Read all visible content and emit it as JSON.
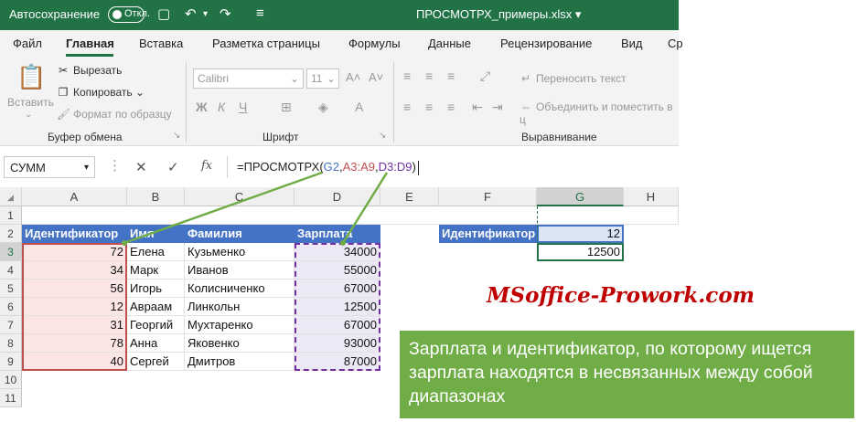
{
  "titlebar": {
    "autosave_label": "Автосохранение",
    "autosave_state": "Откл.",
    "document_title": "ПРОСМОТРХ_примеры.xlsx ▾"
  },
  "menu": {
    "tabs": [
      "Файл",
      "Главная",
      "Вставка",
      "Разметка страницы",
      "Формулы",
      "Данные",
      "Рецензирование",
      "Вид",
      "Ср"
    ],
    "active_tab": "Главная"
  },
  "ribbon": {
    "clipboard": {
      "paste": "Вставить",
      "cut": "Вырезать",
      "copy": "Копировать",
      "format_painter": "Формат по образцу",
      "group": "Буфер обмена"
    },
    "font": {
      "name": "Calibri",
      "size": "11",
      "group": "Шрифт",
      "bold": "Ж",
      "italic": "К",
      "underline": "Ч"
    },
    "alignment": {
      "wrap": "Переносить текст",
      "merge": "Объединить и поместить в ц",
      "group": "Выравнивание"
    }
  },
  "formula_bar": {
    "name_box": "СУММ",
    "cancel": "✕",
    "enter": "✓",
    "fx": "fx",
    "formula_prefix": "=ПРОСМОТРХ(",
    "ref1": "G2",
    "sep1": ",",
    "ref2": "A3:A9",
    "sep2": ",",
    "ref3": "D3:D9",
    "suffix": ")"
  },
  "sheet": {
    "columns": [
      "A",
      "B",
      "C",
      "D",
      "E",
      "F",
      "G",
      "H"
    ],
    "rows": [
      "1",
      "2",
      "3",
      "4",
      "5",
      "6",
      "7",
      "8",
      "9",
      "10",
      "11"
    ],
    "headers": [
      "Идентификатор",
      "Имя",
      "Фамилия",
      "Зарплата"
    ],
    "data": [
      [
        "72",
        "Елена",
        "Кузьменко",
        "34000"
      ],
      [
        "34",
        "Марк",
        "Иванов",
        "55000"
      ],
      [
        "56",
        "Игорь",
        "Колисниченко",
        "67000"
      ],
      [
        "12",
        "Авраам",
        "Линкольн",
        "12500"
      ],
      [
        "31",
        "Георгий",
        "Мухтаренко",
        "67000"
      ],
      [
        "78",
        "Анна",
        "Яковенко",
        "93000"
      ],
      [
        "40",
        "Сергей",
        "Дмитров",
        "87000"
      ]
    ],
    "lookup_label": "Идентификатор",
    "lookup_value": "12",
    "result_value": "12500"
  },
  "watermark": "MSoffice-Prowork.com",
  "callout_text": "Зарплата и идентификатор, по которому ищется зарплата находятся в несвязанных между собой диапазонах",
  "colors": {
    "excel_green": "#217346",
    "header_blue": "#4472c4",
    "callout_green": "#70ad47",
    "ref_red": "#c0504d",
    "ref_purple": "#7030a0"
  }
}
